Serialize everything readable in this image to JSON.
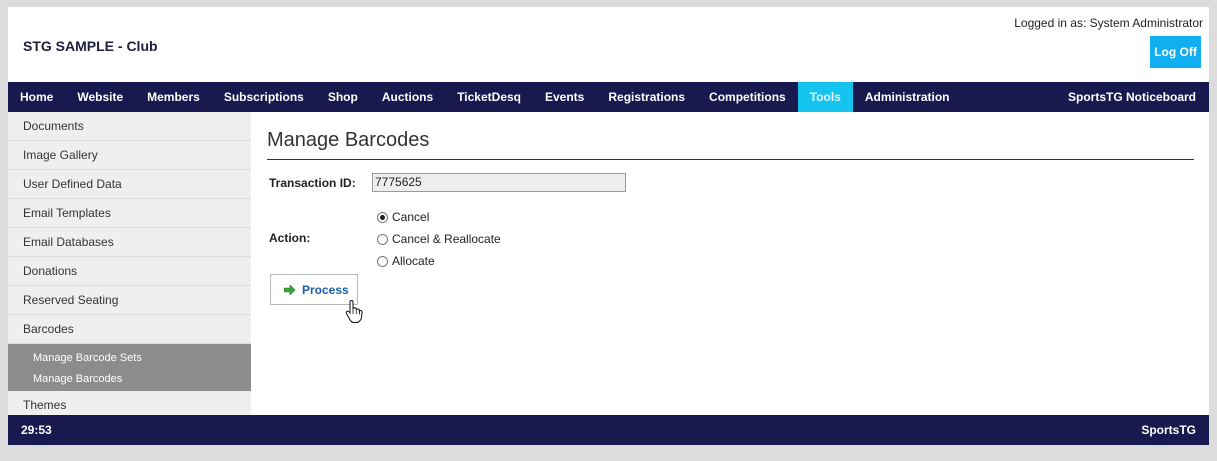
{
  "header": {
    "club_title": "STG SAMPLE - Club",
    "logged_in": "Logged in as: System Administrator",
    "logoff_label": "Log Off"
  },
  "nav": {
    "items": [
      {
        "label": "Home"
      },
      {
        "label": "Website"
      },
      {
        "label": "Members"
      },
      {
        "label": "Subscriptions"
      },
      {
        "label": "Shop"
      },
      {
        "label": "Auctions"
      },
      {
        "label": "TicketDesq"
      },
      {
        "label": "Events"
      },
      {
        "label": "Registrations"
      },
      {
        "label": "Competitions"
      },
      {
        "label": "Tools",
        "active": true
      },
      {
        "label": "Administration"
      }
    ],
    "right_label": "SportsTG Noticeboard"
  },
  "sidebar": {
    "items": [
      {
        "label": "Documents"
      },
      {
        "label": "Image Gallery"
      },
      {
        "label": "User Defined Data"
      },
      {
        "label": "Email Templates"
      },
      {
        "label": "Email Databases"
      },
      {
        "label": "Donations"
      },
      {
        "label": "Reserved Seating"
      },
      {
        "label": "Barcodes"
      }
    ],
    "sub_items": [
      {
        "label": "Manage Barcode Sets"
      },
      {
        "label": "Manage Barcodes"
      }
    ],
    "after_items": [
      {
        "label": "Themes"
      }
    ]
  },
  "main": {
    "title": "Manage Barcodes",
    "transaction_label": "Transaction ID:",
    "transaction_value": "7775625",
    "action_label": "Action:",
    "actions": [
      {
        "label": "Cancel",
        "checked": true
      },
      {
        "label": "Cancel & Reallocate",
        "checked": false
      },
      {
        "label": "Allocate",
        "checked": false
      }
    ],
    "process_label": "Process"
  },
  "footer": {
    "left": "29:53",
    "right": "SportsTG"
  },
  "colors": {
    "nav_bg": "#17194f",
    "active_tab": "#15c3ef",
    "logoff_bg": "#12aef2",
    "process_text": "#1b5fa8",
    "arrow_green": "#3aa43a"
  }
}
